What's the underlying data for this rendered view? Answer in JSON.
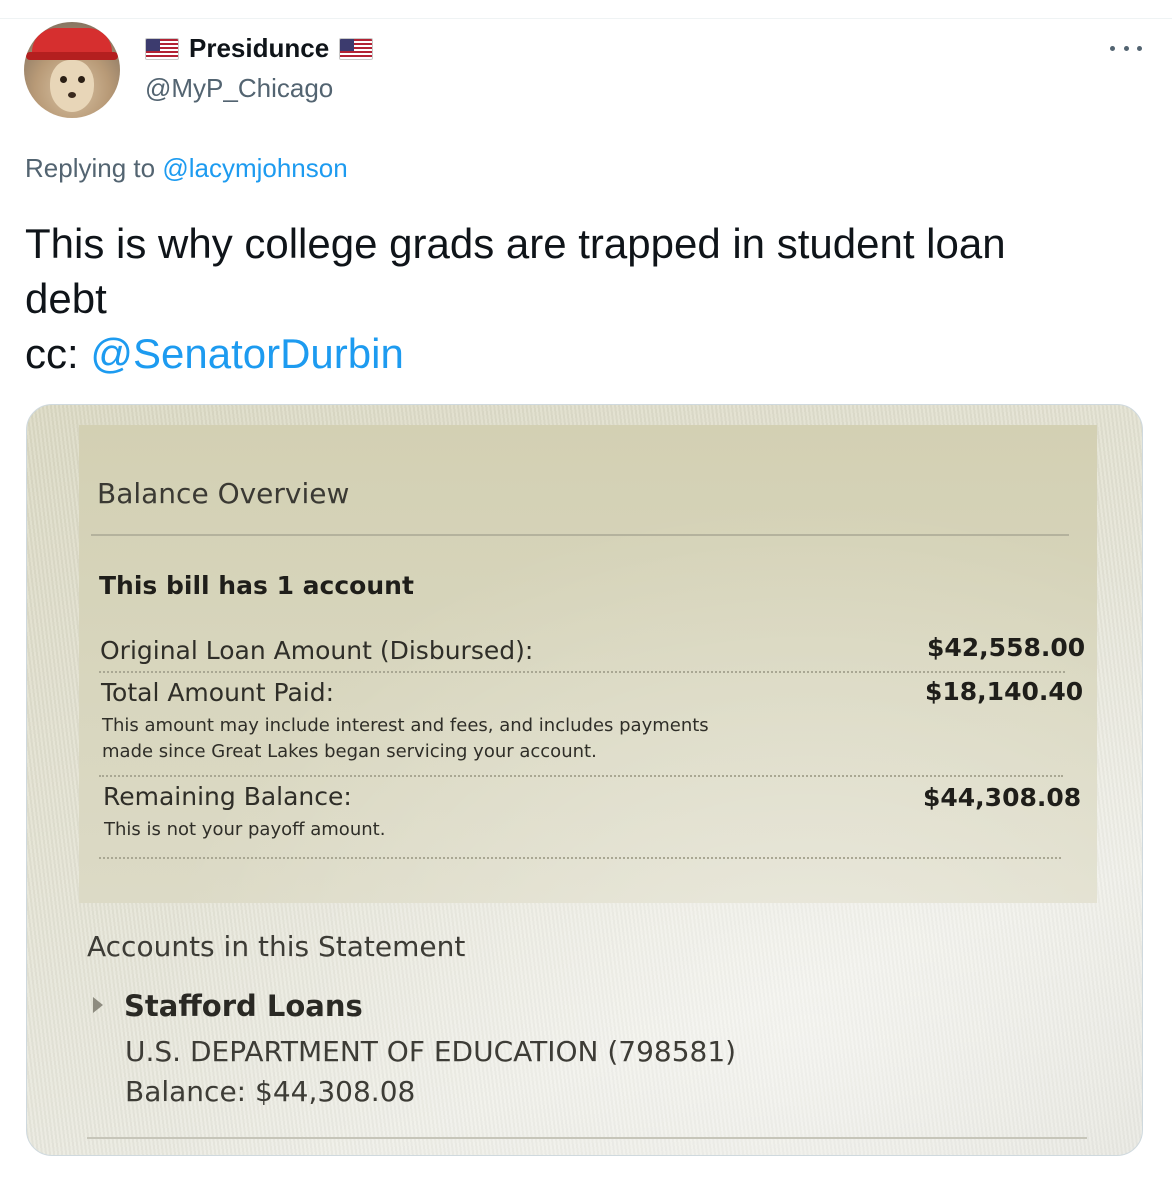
{
  "author": {
    "display_name": "Presidunce",
    "handle": "@MyP_Chicago",
    "flag_icon": "us-flag-icon"
  },
  "reply": {
    "prefix": "Replying to ",
    "mention": "@lacymjohnson"
  },
  "tweet": {
    "line1": "This is why college grads are trapped in student loan",
    "line2": "debt",
    "cc_prefix": "cc: ",
    "cc_mention": "@SenatorDurbin"
  },
  "statement": {
    "heading": "Balance Overview",
    "subheading": "This bill has 1 account",
    "original_label": "Original Loan Amount (Disbursed):",
    "original_value": "$42,558.00",
    "paid_label": "Total Amount Paid:",
    "paid_value": "$18,140.40",
    "paid_note_line1": "This amount may include interest and fees, and includes payments",
    "paid_note_line2": "made since Great Lakes began servicing your account.",
    "remaining_label": "Remaining Balance:",
    "remaining_value": "$44,308.08",
    "remaining_note": "This is not your payoff amount.",
    "accounts_heading": "Accounts in this Statement",
    "loan_name": "Stafford Loans",
    "lender": "U.S. DEPARTMENT OF EDUCATION (798581)",
    "balance": "Balance: $44,308.08"
  },
  "colors": {
    "link": "#1d9bf0",
    "secondary_text": "#536471"
  }
}
